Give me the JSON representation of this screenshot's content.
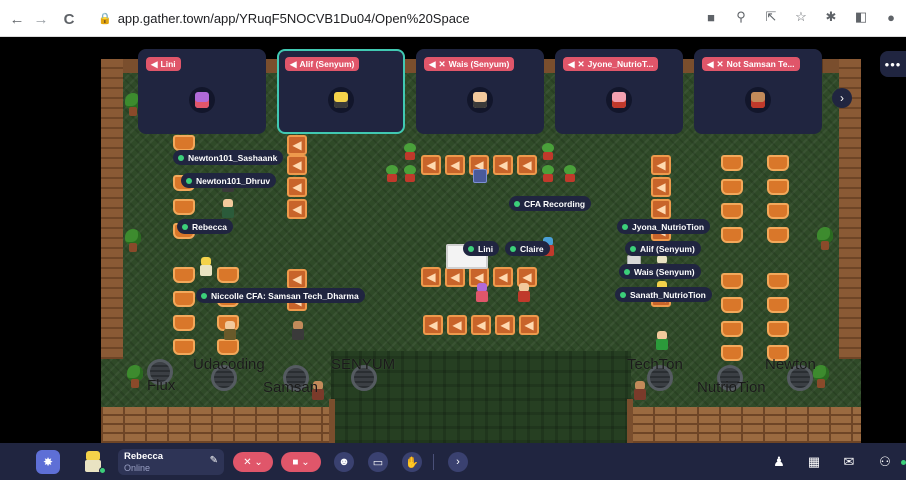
{
  "browser": {
    "url": "app.gather.town/app/YRuqF5NOCVB1Du04/Open%20Space",
    "back_icon": "arrow-left-icon",
    "forward_icon": "arrow-right-icon",
    "reload_icon": "reload-icon",
    "back_glyph": "←",
    "forward_glyph": "→",
    "reload_glyph": "C"
  },
  "video_tiles": [
    {
      "name": "Lini",
      "muted": false
    },
    {
      "name": "Alif (Senyum)",
      "muted": false
    },
    {
      "name": "Wais (Senyum)",
      "muted": true
    },
    {
      "name": "Jyone_NutrioT...",
      "muted": true
    },
    {
      "name": "Not Samsan Te...",
      "muted": true
    }
  ],
  "tile_arrow": "›",
  "more_label": "•••",
  "map_tags": [
    {
      "id": "newton101-sashaank",
      "label": "Newton101_Sashaank"
    },
    {
      "id": "newton101-dhruv",
      "label": "Newton101_Dhruv"
    },
    {
      "id": "rebecca",
      "label": "Rebecca"
    },
    {
      "id": "niccolle",
      "label": "Niccolle CFA: Samsan Tech_Dharma"
    },
    {
      "id": "cfa-recording",
      "label": "CFA Recording"
    },
    {
      "id": "lini",
      "label": "Lini"
    },
    {
      "id": "claire",
      "label": "Claire"
    },
    {
      "id": "jyona",
      "label": "Jyona_NutrioTion"
    },
    {
      "id": "alif",
      "label": "Alif (Senyum)"
    },
    {
      "id": "wais",
      "label": "Wais (Senyum)"
    },
    {
      "id": "sanath",
      "label": "Sanath_NutrioTion"
    }
  ],
  "area_labels": [
    {
      "id": "udacoding",
      "label": "Udacoding"
    },
    {
      "id": "flux",
      "label": "Flux"
    },
    {
      "id": "samsan",
      "label": "Samsan"
    },
    {
      "id": "senyum",
      "label": "SENYUM"
    },
    {
      "id": "techton",
      "label": "TechTon"
    },
    {
      "id": "nutriotion",
      "label": "NutrioTion"
    },
    {
      "id": "newton",
      "label": "Newton"
    }
  ],
  "toolbar": {
    "logo_glyph": "✸",
    "user_name": "Rebecca",
    "user_status": "Online",
    "edit_glyph": "✎",
    "mic_glyph": "✕ ⌄",
    "camera_glyph": "■ ⌄",
    "emoji_glyph": "☻",
    "screen_glyph": "▭",
    "hand_glyph": "✋",
    "expand_glyph": "›",
    "icon_a": "♟",
    "icon_b": "▦",
    "icon_c": "✉",
    "icon_d": "⚇"
  },
  "colors": {
    "toolbar_bg": "#202540",
    "tile_active_border": "#41c9b2",
    "name_badge": "#e0566a",
    "online_dot": "#3ccf7a"
  }
}
